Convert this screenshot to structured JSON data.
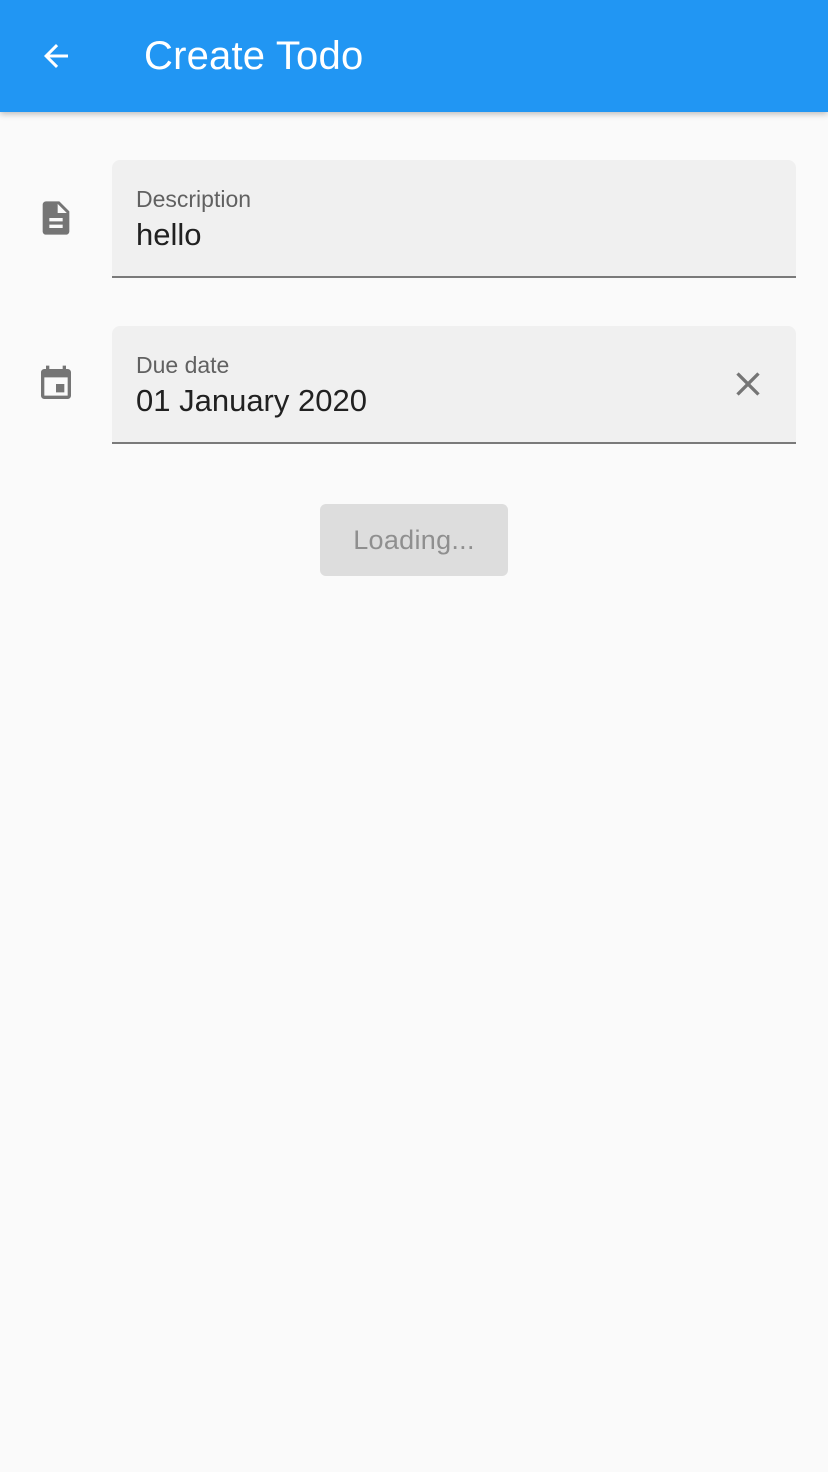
{
  "app_bar": {
    "title": "Create Todo",
    "back_icon": "arrow-back-icon",
    "background_color": "#2196f3"
  },
  "form": {
    "description": {
      "icon": "description-icon",
      "label": "Description",
      "value": "hello"
    },
    "due_date": {
      "icon": "calendar-icon",
      "label": "Due date",
      "value": "01 January 2020",
      "clear_icon": "close-icon"
    },
    "submit": {
      "label": "Loading...",
      "state": "disabled"
    }
  }
}
